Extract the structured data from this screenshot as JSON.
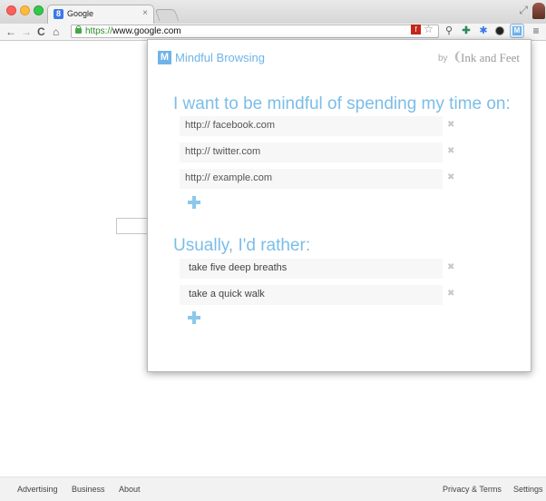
{
  "browser": {
    "tab_title": "Google",
    "tab_favicon": "8",
    "tab_close": "×",
    "url_scheme": "https://",
    "url_host": "www.google.com",
    "nav": {
      "back": "←",
      "forward": "→",
      "reload": "C",
      "home": "⌂"
    },
    "icons": [
      "flash-extension-icon",
      "star-icon",
      "wrench-icon",
      "cross-extension-icon",
      "puzzle-icon",
      "orb-extension-icon",
      "mindful-browsing-icon",
      "menu-icon"
    ],
    "star": "☆",
    "menu": "≡",
    "wrench": "🔧",
    "cross": "✚",
    "puzzle": "✱",
    "fullscreen": "⤢"
  },
  "popup": {
    "title": "Mindful Browsing",
    "by": "by",
    "brand": "Ink and Feet",
    "foot_glyph": "❨",
    "heading_sites": "I want to be mindful of spending my time on:",
    "sites": [
      "http:// facebook.com",
      "http:// twitter.com",
      "http:// example.com"
    ],
    "heading_alternatives": "Usually, I'd rather:",
    "alternatives": [
      "take five deep breaths",
      "take a quick walk"
    ],
    "remove_glyph": "✖"
  },
  "footer": {
    "left": [
      "Advertising",
      "Business",
      "About"
    ],
    "right": [
      "Privacy & Terms",
      "Settings"
    ]
  },
  "colors": {
    "accent": "#6fb4e8",
    "heading": "#7bbde8",
    "row_bg": "#f7f7f7",
    "url_green": "#2c8a2c"
  }
}
